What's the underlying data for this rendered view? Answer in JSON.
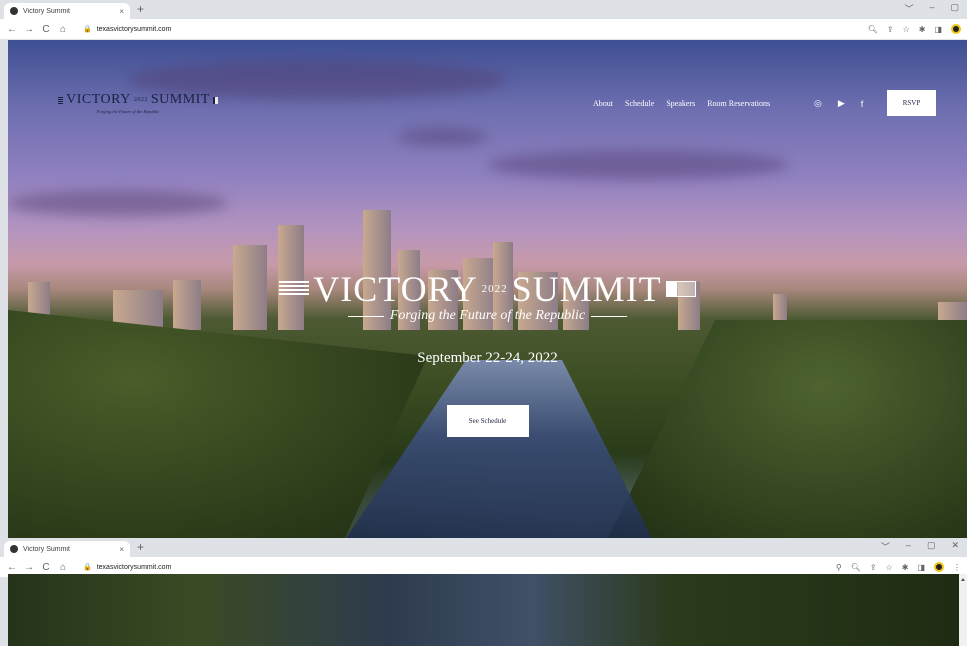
{
  "window1": {
    "tab": {
      "title": "Victory Summit",
      "close": "×"
    },
    "new_tab": "+",
    "controls": [
      "﹀",
      "–",
      "▢"
    ],
    "url": "texasvictorysummit.com",
    "site": {
      "logo": {
        "left": "VICTORY",
        "year": "2022",
        "right": "SUMMIT",
        "tagline": "Forging the Future of the Republic"
      },
      "nav": [
        "About",
        "Schedule",
        "Speakers",
        "Room Reservations"
      ],
      "social_icons": [
        "instagram-icon",
        "youtube-icon",
        "facebook-icon"
      ],
      "rsvp": "RSVP",
      "hero": {
        "title_left": "VICTORY",
        "year": "2022",
        "title_right": "SUMMIT",
        "tagline": "Forging the Future of the Republic",
        "date": "September 22-24, 2022",
        "cta": "See Schedule"
      }
    }
  },
  "window2": {
    "tab": {
      "title": "Victory Summit",
      "close": "×"
    },
    "new_tab": "+",
    "controls": [
      "﹀",
      "–",
      "▢",
      "✕"
    ],
    "url": "texasvictorysummit.com"
  }
}
